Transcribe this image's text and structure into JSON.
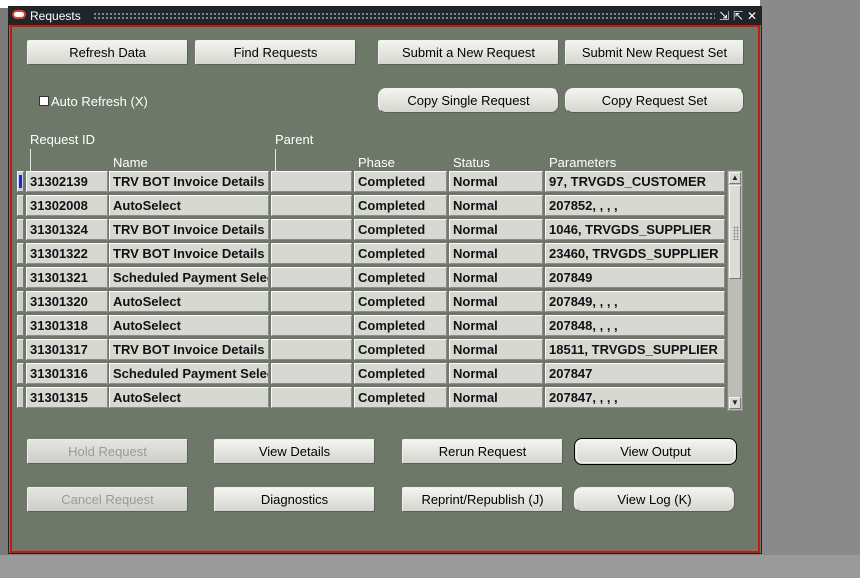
{
  "window": {
    "title": "Requests",
    "controls": [
      "⇲",
      "⇱",
      "✕"
    ]
  },
  "buttons": {
    "refresh_data": "Refresh Data",
    "find_requests": "Find Requests",
    "submit_new_request": "Submit a New Request",
    "submit_new_request_set": "Submit New Request Set",
    "copy_single_request": "Copy Single Request",
    "copy_request_set": "Copy Request Set",
    "hold_request": "Hold Request",
    "view_details": "View Details",
    "rerun_request": "Rerun Request",
    "view_output": "View Output",
    "cancel_request": "Cancel Request",
    "diagnostics": "Diagnostics",
    "reprint_republish": "Reprint/Republish (J)",
    "view_log": "View Log (K)"
  },
  "auto_refresh": {
    "label": "Auto Refresh (X)",
    "checked": false
  },
  "table": {
    "headers": {
      "request_id": "Request ID",
      "parent": "Parent",
      "name": "Name",
      "phase": "Phase",
      "status": "Status",
      "parameters": "Parameters"
    },
    "rows": [
      {
        "id": "31302139",
        "name": "TRV BOT Invoice Details",
        "parent": "",
        "phase": "Completed",
        "status": "Normal",
        "parameters": "97, TRVGDS_CUSTOMER"
      },
      {
        "id": "31302008",
        "name": "AutoSelect",
        "parent": "",
        "phase": "Completed",
        "status": "Normal",
        "parameters": "207852, , , ,"
      },
      {
        "id": "31301324",
        "name": "TRV BOT Invoice Details",
        "parent": "",
        "phase": "Completed",
        "status": "Normal",
        "parameters": "1046, TRVGDS_SUPPLIER"
      },
      {
        "id": "31301322",
        "name": "TRV BOT Invoice Details",
        "parent": "",
        "phase": "Completed",
        "status": "Normal",
        "parameters": "23460, TRVGDS_SUPPLIER"
      },
      {
        "id": "31301321",
        "name": "Scheduled Payment Selection Report",
        "parent": "",
        "phase": "Completed",
        "status": "Normal",
        "parameters": "207849"
      },
      {
        "id": "31301320",
        "name": "AutoSelect",
        "parent": "",
        "phase": "Completed",
        "status": "Normal",
        "parameters": "207849, , , ,"
      },
      {
        "id": "31301318",
        "name": "AutoSelect",
        "parent": "",
        "phase": "Completed",
        "status": "Normal",
        "parameters": "207848, , , ,"
      },
      {
        "id": "31301317",
        "name": "TRV BOT Invoice Details",
        "parent": "",
        "phase": "Completed",
        "status": "Normal",
        "parameters": "18511, TRVGDS_SUPPLIER"
      },
      {
        "id": "31301316",
        "name": "Scheduled Payment Selection Report",
        "parent": "",
        "phase": "Completed",
        "status": "Normal",
        "parameters": "207847"
      },
      {
        "id": "31301315",
        "name": "AutoSelect",
        "parent": "",
        "phase": "Completed",
        "status": "Normal",
        "parameters": "207847, , , ,"
      }
    ],
    "selected_row": 0
  },
  "colors": {
    "window_bg": "#6e7868",
    "title_bar": "#1f2529",
    "accent_border": "#c41a12",
    "selection_marker": "#1a2ccf"
  }
}
